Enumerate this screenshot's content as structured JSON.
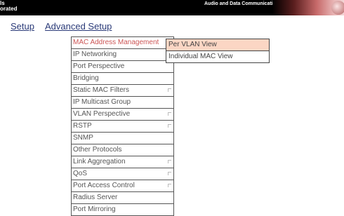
{
  "header": {
    "company_name": "ls\norated",
    "product_line": "Audio and Data Communication Products"
  },
  "nav": {
    "setup_label": "Setup",
    "advanced_setup_label": "Advanced Setup"
  },
  "menu": {
    "items": [
      {
        "label": "MAC Address Management",
        "active": true,
        "has_submenu": true
      },
      {
        "label": "IP Networking",
        "has_submenu": false
      },
      {
        "label": "Port Perspective",
        "has_submenu": false
      },
      {
        "label": "Bridging",
        "has_submenu": false
      },
      {
        "label": "Static MAC Filters",
        "has_submenu": true
      },
      {
        "label": "IP Multicast Group",
        "has_submenu": false
      },
      {
        "label": "VLAN Perspective",
        "has_submenu": true
      },
      {
        "label": "RSTP",
        "has_submenu": true
      },
      {
        "label": "SNMP",
        "has_submenu": false
      },
      {
        "label": "Other Protocols",
        "has_submenu": false
      },
      {
        "label": "Link Aggregation",
        "has_submenu": true
      },
      {
        "label": "QoS",
        "has_submenu": true
      },
      {
        "label": "Port Access Control",
        "has_submenu": true
      },
      {
        "label": "Radius Server",
        "has_submenu": false
      },
      {
        "label": "Port Mirroring",
        "has_submenu": false
      }
    ]
  },
  "submenu": {
    "items": [
      {
        "label": "Per VLAN View",
        "highlighted": true
      },
      {
        "label": "Individual MAC View",
        "highlighted": false
      }
    ]
  },
  "colors": {
    "nav_link": "#2a3a78",
    "active_menu_text": "#cc5555",
    "submenu_highlight": "#fbd6c4",
    "header_background": "#000000"
  }
}
